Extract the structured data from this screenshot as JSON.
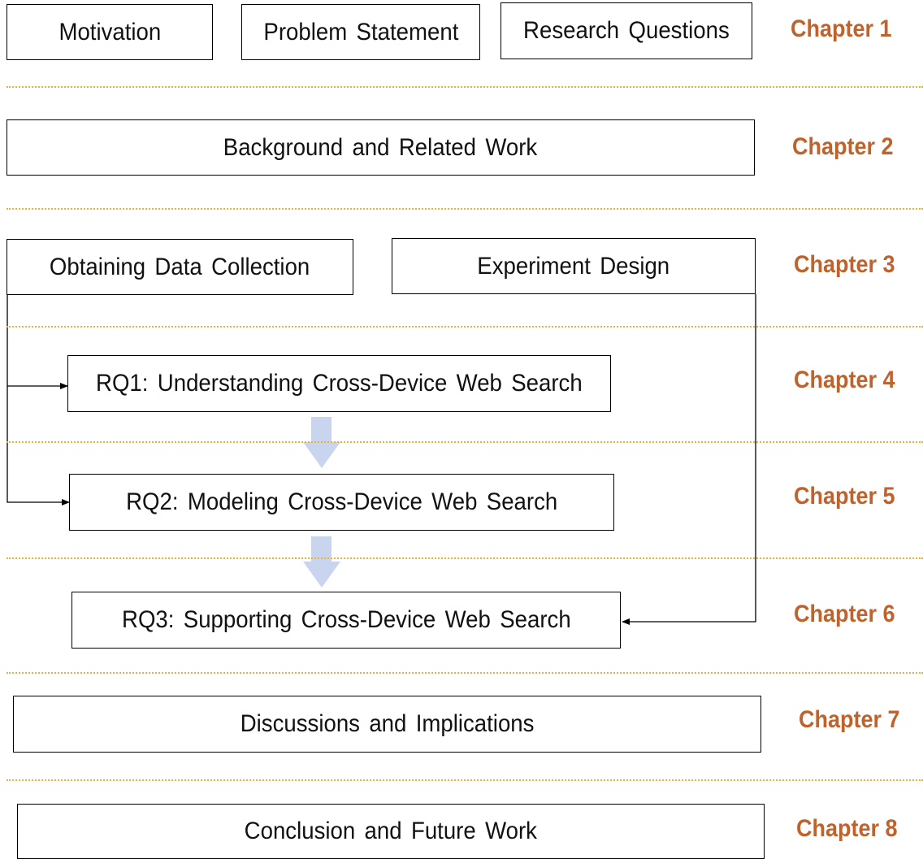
{
  "colors": {
    "chapter_label": "#C0622B",
    "separator": "#E8B23A",
    "flow_arrow": "#C6D3EE",
    "box_border": "#000000"
  },
  "chapters": [
    {
      "label": "Chapter 1",
      "boxes": [
        "Motivation",
        "Problem Statement",
        "Research Questions"
      ]
    },
    {
      "label": "Chapter 2",
      "boxes": [
        "Background and Related Work"
      ]
    },
    {
      "label": "Chapter 3",
      "boxes": [
        "Obtaining Data Collection",
        "Experiment Design"
      ]
    },
    {
      "label": "Chapter 4",
      "boxes": [
        "RQ1: Understanding Cross-Device Web Search"
      ]
    },
    {
      "label": "Chapter 5",
      "boxes": [
        "RQ2: Modeling Cross-Device Web Search"
      ]
    },
    {
      "label": "Chapter 6",
      "boxes": [
        "RQ3: Supporting Cross-Device Web Search"
      ]
    },
    {
      "label": "Chapter 7",
      "boxes": [
        "Discussions and Implications"
      ]
    },
    {
      "label": "Chapter 8",
      "boxes": [
        "Conclusion and Future Work"
      ]
    }
  ],
  "edges": [
    {
      "from": "Obtaining Data Collection",
      "to": "RQ1: Understanding Cross-Device Web Search"
    },
    {
      "from": "Obtaining Data Collection",
      "to": "RQ2: Modeling Cross-Device Web Search"
    },
    {
      "from": "Experiment Design",
      "to": "RQ3: Supporting Cross-Device Web Search"
    },
    {
      "from": "RQ1: Understanding Cross-Device Web Search",
      "to": "RQ2: Modeling Cross-Device Web Search"
    },
    {
      "from": "RQ2: Modeling Cross-Device Web Search",
      "to": "RQ3: Supporting Cross-Device Web Search"
    }
  ]
}
